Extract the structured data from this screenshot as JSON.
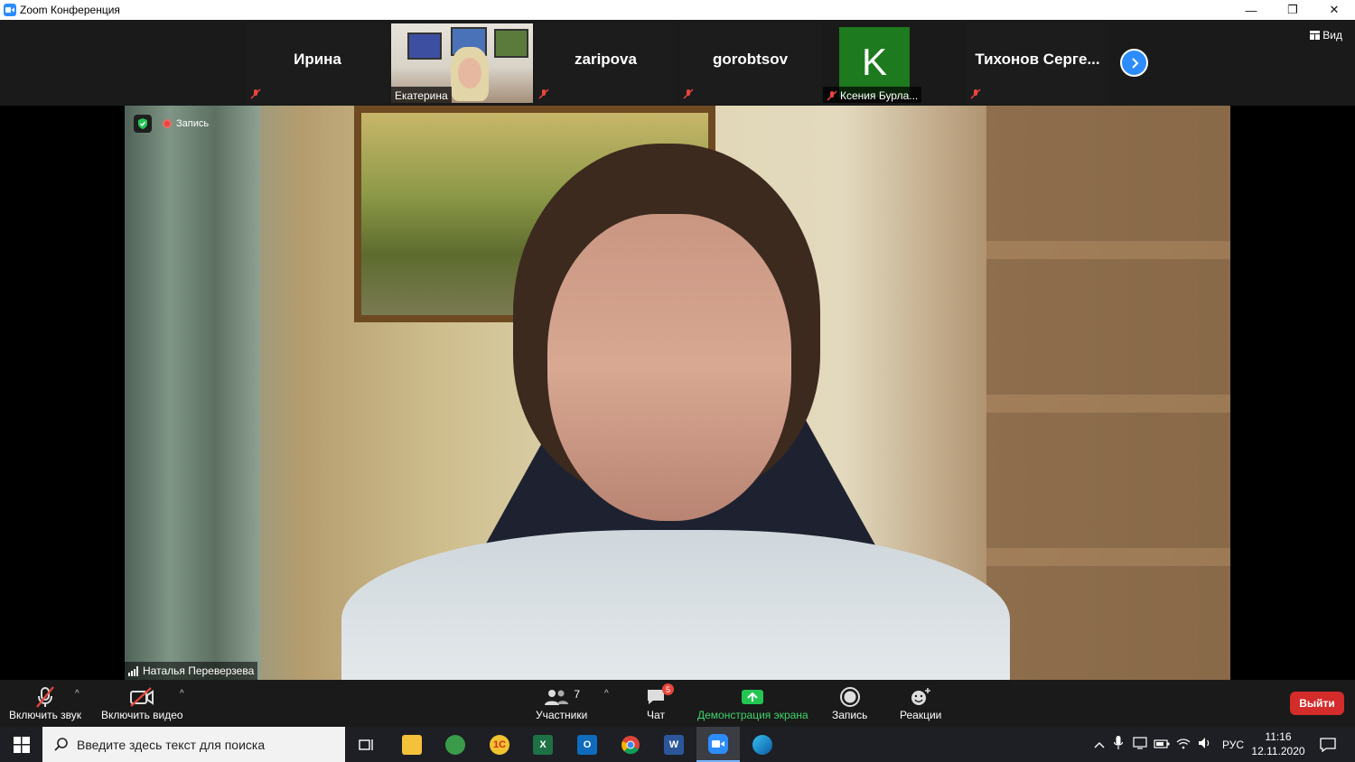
{
  "window": {
    "title": "Zoom Конференция",
    "controls": {
      "minimize": "—",
      "restore": "❐",
      "close": "✕"
    }
  },
  "gallery": {
    "tiles": [
      {
        "name": "Ирина",
        "muted": true
      },
      {
        "name": "Екатерина",
        "muted": false
      },
      {
        "name": "zaripova",
        "muted": true
      },
      {
        "name": "gorobtsov",
        "muted": true
      },
      {
        "name": "Ксения Бурла...",
        "avatar_letter": "K",
        "muted": true
      },
      {
        "name": "Тихонов Серге...",
        "muted": true
      }
    ],
    "view_label": "Вид"
  },
  "main_video": {
    "recording_label": "Запись",
    "speaker_name": "Наталья Переверзева"
  },
  "toolbar": {
    "unmute_label": "Включить звук",
    "start_video_label": "Включить видео",
    "participants_label": "Участники",
    "participants_count": "7",
    "chat_label": "Чат",
    "chat_badge": "5",
    "share_label": "Демонстрация экрана",
    "record_label": "Запись",
    "reactions_label": "Реакции",
    "leave_label": "Выйти"
  },
  "taskbar": {
    "search_placeholder": "Введите здесь текст для поиска",
    "language": "РУС",
    "time": "11:16",
    "date": "12.11.2020"
  },
  "colors": {
    "zoom_blue": "#2d8cff",
    "share_green": "#3fd36a",
    "leave_red": "#d42b2b",
    "avatar_green": "#1e7a1e"
  }
}
